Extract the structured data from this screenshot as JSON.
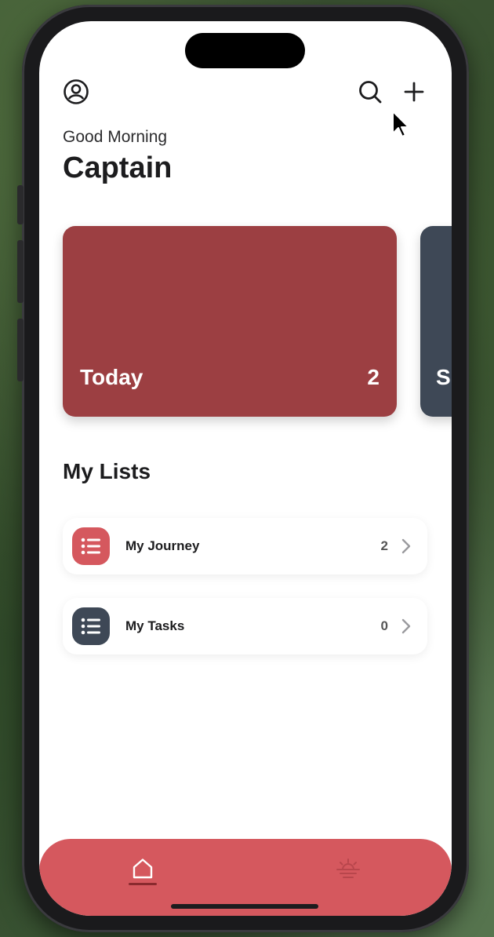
{
  "header": {
    "profile_icon": "person-circle-icon",
    "search_icon": "search-icon",
    "add_icon": "plus-icon"
  },
  "greeting": {
    "subtitle": "Good Morning",
    "name": "Captain"
  },
  "cards": [
    {
      "label": "Today",
      "count": "2",
      "color": "#9c3f42"
    },
    {
      "label": "S",
      "color": "#3e4856"
    }
  ],
  "lists": {
    "title": "My Lists",
    "items": [
      {
        "label": "My Journey",
        "count": "2",
        "icon": "list-icon",
        "color": "#d5585e"
      },
      {
        "label": "My Tasks",
        "count": "0",
        "icon": "list-icon",
        "color": "#3e4856"
      }
    ]
  },
  "tabbar": {
    "color": "#d5585e",
    "tabs": [
      {
        "icon": "home-icon",
        "selected": true
      },
      {
        "icon": "sunrise-icon",
        "selected": false
      }
    ]
  }
}
